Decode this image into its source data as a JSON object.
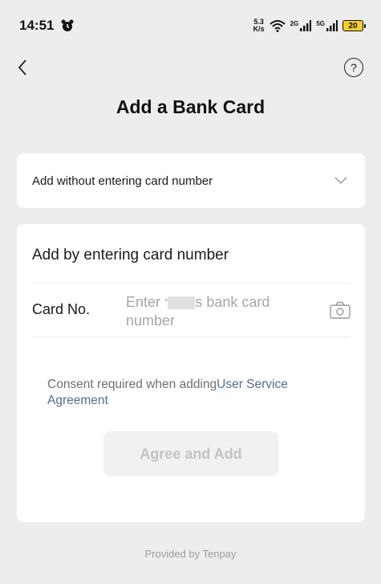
{
  "status_bar": {
    "time": "14:51",
    "net_speed_value": "5.3",
    "net_speed_unit": "K/s",
    "sig1_label": "2G",
    "sig2_label": "5G",
    "battery": "20"
  },
  "nav": {
    "title": "Add a Bank Card",
    "help_glyph": "?"
  },
  "quick_add": {
    "label": "Add without entering card number"
  },
  "manual_add": {
    "title": "Add by entering card number",
    "card_no_label": "Card No.",
    "placeholder_prefix": "Enter ",
    "placeholder_masked": "*",
    "placeholder_suffix": "s bank card number"
  },
  "consent": {
    "text": "Consent required when adding",
    "link": "User Service Agreement"
  },
  "agree_button": "Agree and Add",
  "footer": "Provided by Tenpay",
  "colors": {
    "background": "#ededed",
    "link": "#576b95",
    "battery": "#f5cc2b",
    "button_disabled_text": "#c3c3c3"
  }
}
